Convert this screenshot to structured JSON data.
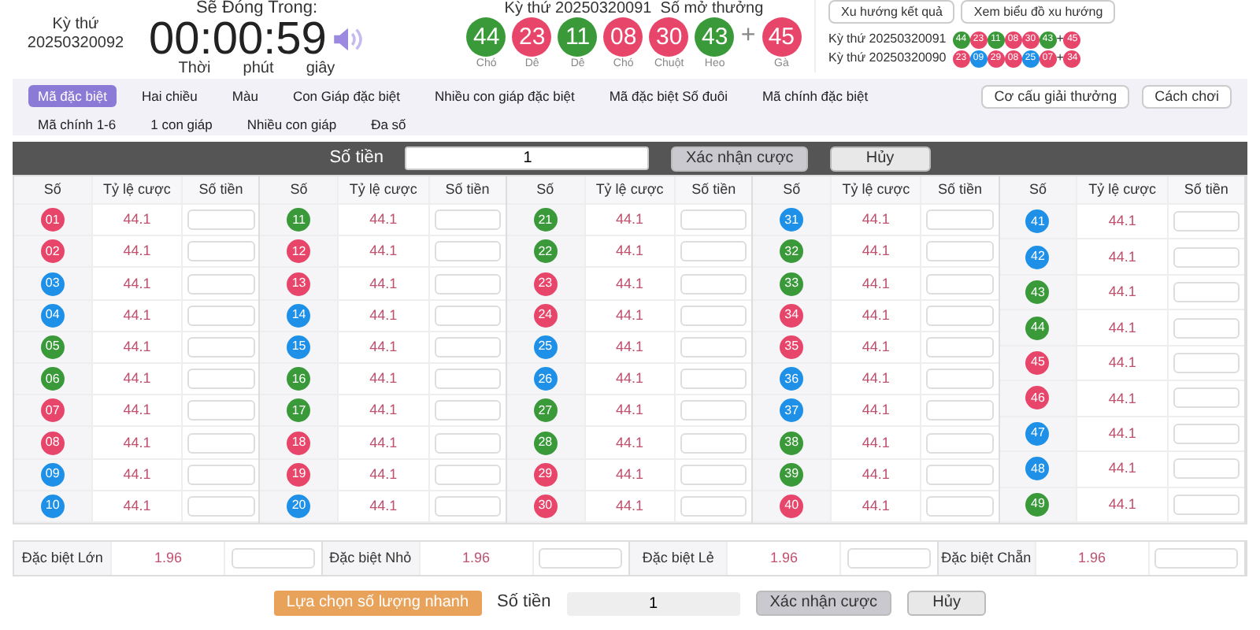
{
  "countdown": {
    "period_label": "Kỳ thứ",
    "period": "20250320092",
    "title": "Sẽ Đóng Trong:",
    "time": "00:00:59",
    "units": [
      "Thời",
      "phút",
      "giây"
    ]
  },
  "latest": {
    "title": "Kỳ thứ 20250320091  Số mở thưởng",
    "plus": "+",
    "balls": [
      {
        "number": "44",
        "color": "#3a9a3a",
        "zodiac": "Chó"
      },
      {
        "number": "23",
        "color": "#e8456b",
        "zodiac": "Dê"
      },
      {
        "number": "11",
        "color": "#3a9a3a",
        "zodiac": "Dê"
      },
      {
        "number": "08",
        "color": "#e8456b",
        "zodiac": "Chó"
      },
      {
        "number": "30",
        "color": "#e8456b",
        "zodiac": "Chuột"
      },
      {
        "number": "43",
        "color": "#3a9a3a",
        "zodiac": "Heo"
      }
    ],
    "bonus": {
      "number": "45",
      "color": "#e8456b",
      "zodiac": "Gà"
    }
  },
  "history_buttons": [
    "Xu hướng kết quả",
    "Xem biểu đồ xu hướng"
  ],
  "history": [
    {
      "label": "Kỳ thứ 20250320091",
      "plus": "+",
      "balls": [
        {
          "number": "44",
          "color": "#3a9a3a"
        },
        {
          "number": "23",
          "color": "#e8456b"
        },
        {
          "number": "11",
          "color": "#3a9a3a"
        },
        {
          "number": "08",
          "color": "#e8456b"
        },
        {
          "number": "30",
          "color": "#e8456b"
        },
        {
          "number": "43",
          "color": "#3a9a3a"
        }
      ],
      "bonus": {
        "number": "45",
        "color": "#e8456b"
      }
    },
    {
      "label": "Kỳ thứ 20250320090",
      "plus": "+",
      "balls": [
        {
          "number": "23",
          "color": "#e8456b"
        },
        {
          "number": "09",
          "color": "#1e90e8"
        },
        {
          "number": "29",
          "color": "#e8456b"
        },
        {
          "number": "08",
          "color": "#e8456b"
        },
        {
          "number": "25",
          "color": "#1e90e8"
        },
        {
          "number": "07",
          "color": "#e8456b"
        }
      ],
      "bonus": {
        "number": "34",
        "color": "#e8456b"
      }
    }
  ],
  "tabs": [
    {
      "label": "Mã đặc biệt",
      "selected": true
    },
    {
      "label": "Hai chiều",
      "selected": false
    },
    {
      "label": "Màu",
      "selected": false
    },
    {
      "label": "Con Giáp đặc biệt",
      "selected": false
    },
    {
      "label": "Nhiều con giáp đặc biệt",
      "selected": false
    },
    {
      "label": "Mã đặc biệt Số đuôi",
      "selected": false
    },
    {
      "label": "Mã chính đặc biệt",
      "selected": false
    },
    {
      "label": "Mã chính 1-6",
      "selected": false
    },
    {
      "label": "1 con giáp",
      "selected": false
    },
    {
      "label": "Nhiều con giáp",
      "selected": false
    },
    {
      "label": "Đa số",
      "selected": false
    }
  ],
  "side_buttons": [
    "Cơ cấu giải thưởng",
    "Cách chơi"
  ],
  "top_bet_bar": {
    "label": "Số tiền",
    "value": "1",
    "confirm": "Xác nhận cược",
    "cancel": "Hủy"
  },
  "table": {
    "groups": [
      {
        "columns": [
          "Số",
          "Tỷ lệ cược",
          "Số tiền"
        ],
        "rows": [
          {
            "number": "01",
            "color": "#e8456b",
            "odds": "44.1"
          },
          {
            "number": "02",
            "color": "#e8456b",
            "odds": "44.1"
          },
          {
            "number": "03",
            "color": "#1e90e8",
            "odds": "44.1"
          },
          {
            "number": "04",
            "color": "#1e90e8",
            "odds": "44.1"
          },
          {
            "number": "05",
            "color": "#3a9a3a",
            "odds": "44.1"
          },
          {
            "number": "06",
            "color": "#3a9a3a",
            "odds": "44.1"
          },
          {
            "number": "07",
            "color": "#e8456b",
            "odds": "44.1"
          },
          {
            "number": "08",
            "color": "#e8456b",
            "odds": "44.1"
          },
          {
            "number": "09",
            "color": "#1e90e8",
            "odds": "44.1"
          },
          {
            "number": "10",
            "color": "#1e90e8",
            "odds": "44.1"
          }
        ]
      },
      {
        "columns": [
          "Số",
          "Tỷ lệ cược",
          "Số tiền"
        ],
        "rows": [
          {
            "number": "11",
            "color": "#3a9a3a",
            "odds": "44.1"
          },
          {
            "number": "12",
            "color": "#e8456b",
            "odds": "44.1"
          },
          {
            "number": "13",
            "color": "#e8456b",
            "odds": "44.1"
          },
          {
            "number": "14",
            "color": "#1e90e8",
            "odds": "44.1"
          },
          {
            "number": "15",
            "color": "#1e90e8",
            "odds": "44.1"
          },
          {
            "number": "16",
            "color": "#3a9a3a",
            "odds": "44.1"
          },
          {
            "number": "17",
            "color": "#3a9a3a",
            "odds": "44.1"
          },
          {
            "number": "18",
            "color": "#e8456b",
            "odds": "44.1"
          },
          {
            "number": "19",
            "color": "#e8456b",
            "odds": "44.1"
          },
          {
            "number": "20",
            "color": "#1e90e8",
            "odds": "44.1"
          }
        ]
      },
      {
        "columns": [
          "Số",
          "Tỷ lệ cược",
          "Số tiền"
        ],
        "rows": [
          {
            "number": "21",
            "color": "#3a9a3a",
            "odds": "44.1"
          },
          {
            "number": "22",
            "color": "#3a9a3a",
            "odds": "44.1"
          },
          {
            "number": "23",
            "color": "#e8456b",
            "odds": "44.1"
          },
          {
            "number": "24",
            "color": "#e8456b",
            "odds": "44.1"
          },
          {
            "number": "25",
            "color": "#1e90e8",
            "odds": "44.1"
          },
          {
            "number": "26",
            "color": "#1e90e8",
            "odds": "44.1"
          },
          {
            "number": "27",
            "color": "#3a9a3a",
            "odds": "44.1"
          },
          {
            "number": "28",
            "color": "#3a9a3a",
            "odds": "44.1"
          },
          {
            "number": "29",
            "color": "#e8456b",
            "odds": "44.1"
          },
          {
            "number": "30",
            "color": "#e8456b",
            "odds": "44.1"
          }
        ]
      },
      {
        "columns": [
          "Số",
          "Tỷ lệ cược",
          "Số tiền"
        ],
        "rows": [
          {
            "number": "31",
            "color": "#1e90e8",
            "odds": "44.1"
          },
          {
            "number": "32",
            "color": "#3a9a3a",
            "odds": "44.1"
          },
          {
            "number": "33",
            "color": "#3a9a3a",
            "odds": "44.1"
          },
          {
            "number": "34",
            "color": "#e8456b",
            "odds": "44.1"
          },
          {
            "number": "35",
            "color": "#e8456b",
            "odds": "44.1"
          },
          {
            "number": "36",
            "color": "#1e90e8",
            "odds": "44.1"
          },
          {
            "number": "37",
            "color": "#1e90e8",
            "odds": "44.1"
          },
          {
            "number": "38",
            "color": "#3a9a3a",
            "odds": "44.1"
          },
          {
            "number": "39",
            "color": "#3a9a3a",
            "odds": "44.1"
          },
          {
            "number": "40",
            "color": "#e8456b",
            "odds": "44.1"
          }
        ]
      },
      {
        "columns": [
          "Số",
          "Tỷ lệ cược",
          "Số tiền"
        ],
        "rows": [
          {
            "number": "41",
            "color": "#1e90e8",
            "odds": "44.1"
          },
          {
            "number": "42",
            "color": "#1e90e8",
            "odds": "44.1"
          },
          {
            "number": "43",
            "color": "#3a9a3a",
            "odds": "44.1"
          },
          {
            "number": "44",
            "color": "#3a9a3a",
            "odds": "44.1"
          },
          {
            "number": "45",
            "color": "#e8456b",
            "odds": "44.1"
          },
          {
            "number": "46",
            "color": "#e8456b",
            "odds": "44.1"
          },
          {
            "number": "47",
            "color": "#1e90e8",
            "odds": "44.1"
          },
          {
            "number": "48",
            "color": "#1e90e8",
            "odds": "44.1"
          },
          {
            "number": "49",
            "color": "#3a9a3a",
            "odds": "44.1"
          }
        ]
      }
    ]
  },
  "special_bets": [
    {
      "label": "Đặc biệt Lớn",
      "odds": "1.96"
    },
    {
      "label": "Đặc biệt Nhỏ",
      "odds": "1.96"
    },
    {
      "label": "Đặc biệt Lẻ",
      "odds": "1.96"
    },
    {
      "label": "Đặc biệt Chẵn",
      "odds": "1.96"
    }
  ],
  "bottom_bet_bar": {
    "quick": "Lựa chọn số lượng nhanh",
    "label": "Số tiền",
    "value": "1",
    "confirm": "Xác nhận cược",
    "cancel": "Hủy"
  }
}
